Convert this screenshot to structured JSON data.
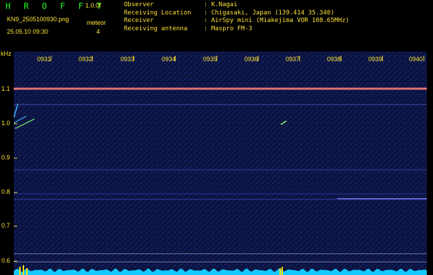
{
  "header": {
    "app_title": "H R O F F T",
    "version": "1.0.0f",
    "filename": "KN9_2505100930.png",
    "mode_label": "meteor",
    "mode_value": "4",
    "datetime": "25.05.10 09:30",
    "observer_label": "Observer",
    "observer_value": ": K.Nagai",
    "location_label": "Receiving Location",
    "location_value": ": Chigasaki, Japan (139.414 35.340)",
    "receiver_label": "Receiver",
    "receiver_value": ": AirSpy mini (Miakejima VOR 108.65MHz)",
    "antenna_label": "Receiving antenna",
    "antenna_value": ": Maspro FM-3"
  },
  "axis": {
    "y_unit": "kHz",
    "y_ticks": [
      "1.1",
      "1.0",
      "0.9",
      "0.8",
      "0.7",
      "0.6"
    ],
    "x_ticks": [
      "0931",
      "0932",
      "0933",
      "0934",
      "0935",
      "0936",
      "0937",
      "0938",
      "0939",
      "0940"
    ]
  },
  "colors": {
    "background": "#000000",
    "label_yellow": "#ffe433",
    "title_green": "#21ff21",
    "spectrum_blue": "#1b2aa8",
    "signal_line": "#ff8866",
    "baseline_cyan": "#15c8ff"
  }
}
